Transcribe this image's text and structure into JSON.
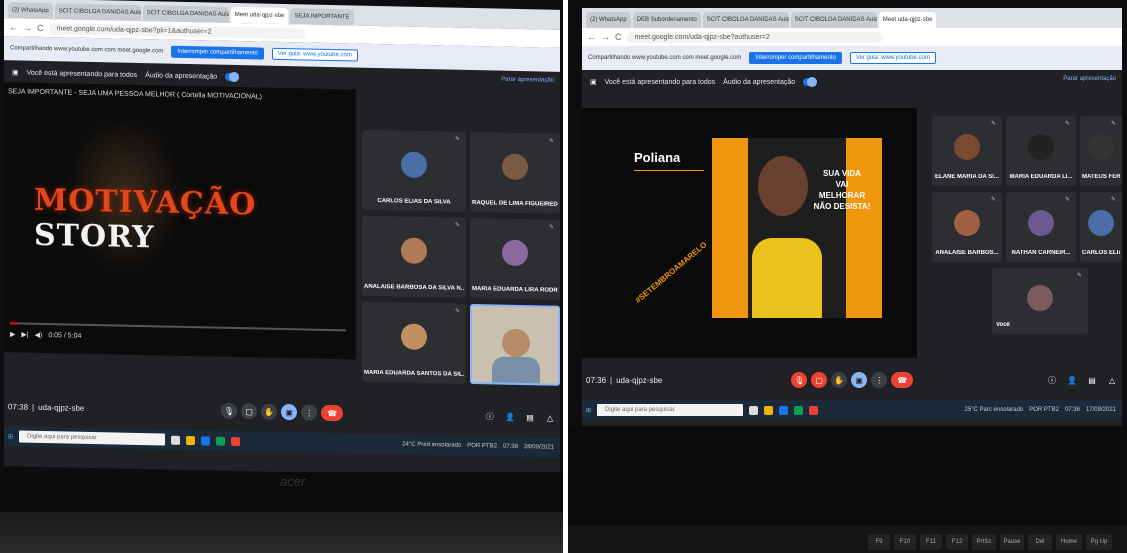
{
  "left": {
    "tabs": [
      "(2) WhatsApp",
      "SCIT CIBOLGA DANIDAS Aula",
      "SCIT CIBOLGA DANIDAS Aula",
      "Meet uda-qjpz-sbe",
      "SEJA IMPORTANTE"
    ],
    "url": "meet.google.com/uda-qjpz-sbe?pli=1&authuser=2",
    "share_text": "Compartilhando www.youtube.com com meet.google.com",
    "stop_share": "Interromper compartilhamento",
    "go_to_tab": "Ver guia: www.youtube.com",
    "presenting_text": "Você está apresentando para todos",
    "presentation_audio": "Áudio da apresentação",
    "stop_presenting": "Parar apresentação",
    "video_title": "SEJA IMPORTANTE - SEJA UMA PESSOA MELHOR ( Cortella MOTIVACIONAL)",
    "video_text_a": "MOTIVAÇÃO",
    "video_text_b": "STORY",
    "video_time": "0:05 / 5:04",
    "video_progress": 0.02,
    "participants": [
      {
        "name": "CARLOS ELIAS DA SILVA",
        "color": "#4a6ea8"
      },
      {
        "name": "RAQUEL DE LIMA FIGUEIREDO",
        "color": "#7a5a44"
      },
      {
        "name": "ANALAISE BARBOSA DA SILVA N...",
        "color": "#b07a56"
      },
      {
        "name": "MARIA EDUARDA LIRA RODRIGU...",
        "color": "#8a6aa0"
      },
      {
        "name": "MARIA EDUARDA SANTOS DA SIL...",
        "color": "#c09060"
      }
    ],
    "meeting_time": "07:38",
    "meeting_code": "uda-qjpz-sbe",
    "taskbar_search": "Digite aqui para pesquisar",
    "weather": "24°C  Pred ensolarado",
    "lang": "POR PTB2",
    "clock": "07:38",
    "date": "28/09/2021",
    "brand": "acer"
  },
  "right": {
    "tabs": [
      "(2) WhatsApp",
      "DEB Subordenamento",
      "SCIT CIBOLGA DANIDAS Aula",
      "SCIT CIBOLGA DANIDAS Aula",
      "Meet uda-qjpz-sbe"
    ],
    "url": "meet.google.com/uda-qjpz-sbe?authuser=2",
    "share_text": "Compartilhando www.youtube.com com meet.google.com",
    "stop_share": "Interromper compartilhamento",
    "go_to_tab": "Ver guia: www.youtube.com",
    "presenting_text": "Você está apresentando para todos",
    "presentation_audio": "Áudio da apresentação",
    "stop_presenting": "Parar apresentação",
    "poster_name": "Poliana",
    "poster_line1": "SUA VIDA",
    "poster_line2": "VAI",
    "poster_line3": "MELHORAR",
    "poster_line4": "NÃO DESISTA!",
    "poster_tag": "#SETEMBROAMARELO",
    "participants": [
      {
        "name": "ELANE MARIA DA SI...",
        "color": "#7a4a30"
      },
      {
        "name": "MARIA EDUARDA LI...",
        "color": "#222"
      },
      {
        "name": "MATEUS FERNAND...",
        "color": "#333"
      },
      {
        "name": "ANALAISE BARBOS...",
        "color": "#a06040"
      },
      {
        "name": "NATHAN CARNEIR...",
        "color": "#6a5a90"
      },
      {
        "name": "CARLOS ELIAS DA...",
        "color": "#4a6ea8"
      },
      {
        "name": "Você",
        "color": "#7a5a5a"
      }
    ],
    "meeting_time": "07:36",
    "meeting_code": "uda-qjpz-sbe",
    "taskbar_search": "Digite aqui para pesquisar",
    "weather": "25°C  Parc ensolarado",
    "lang": "POR PTB2",
    "clock": "07:36",
    "date": "17/09/2021",
    "keys": [
      "F9",
      "F10",
      "F11",
      "F12",
      "PrtSc",
      "Pause",
      "Del",
      "Home",
      "Pg Up"
    ]
  },
  "colors": {
    "meet_bg": "#202124",
    "accent": "#1a73e8",
    "end_call": "#ea4335",
    "poster_orange": "#f0960e"
  }
}
